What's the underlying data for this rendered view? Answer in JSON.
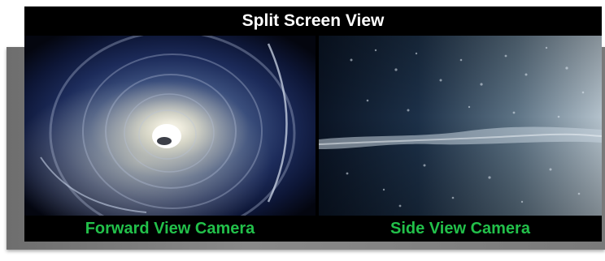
{
  "title": "Split Screen View",
  "panes": [
    {
      "label": "Forward View Camera",
      "image": "pipe-forward-view"
    },
    {
      "label": "Side View Camera",
      "image": "pipe-wall-side-view"
    }
  ],
  "colors": {
    "frame": "#000000",
    "title_text": "#ffffff",
    "caption_text": "#22c04a",
    "backdrop": "#7a7a7a"
  }
}
